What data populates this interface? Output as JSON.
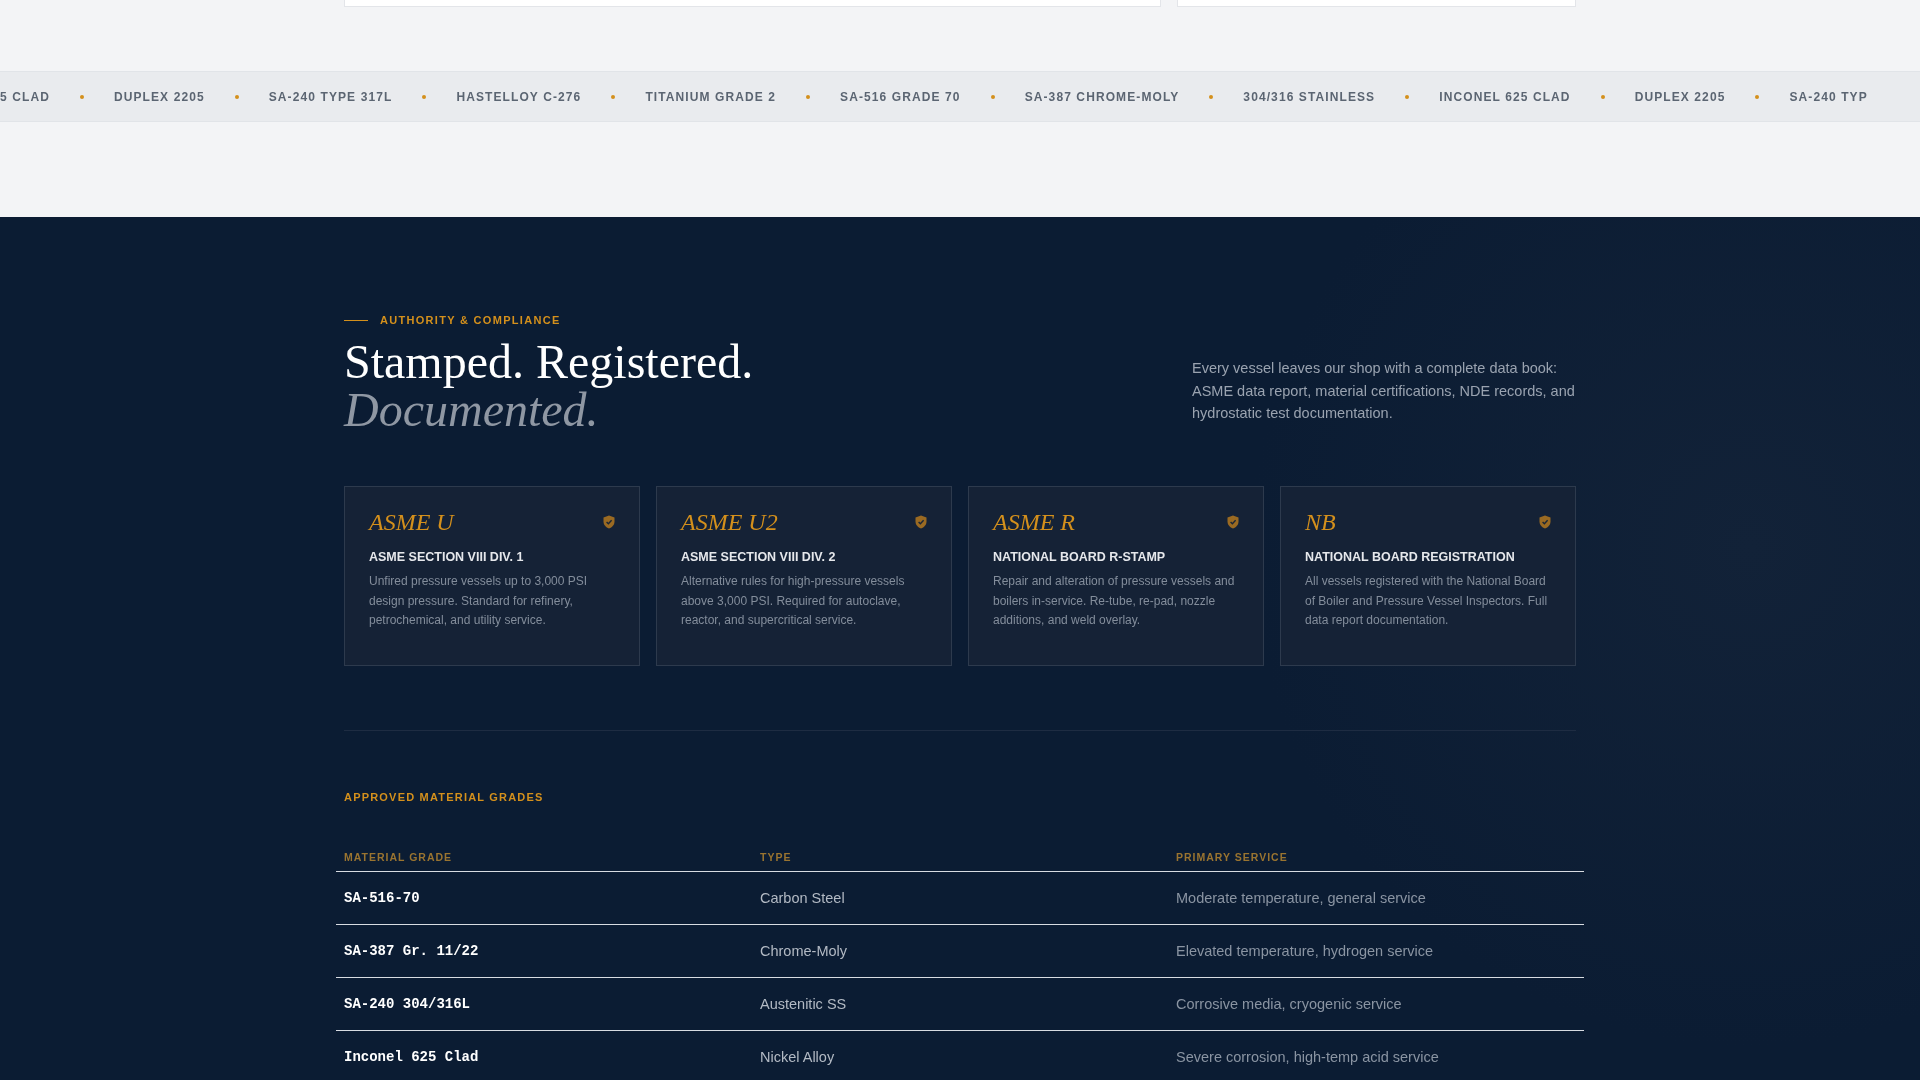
{
  "ticker": [
    "5 CLAD",
    "DUPLEX 2205",
    "SA-240 TYPE 317L",
    "HASTELLOY C-276",
    "TITANIUM GRADE 2",
    "SA-516 GRADE 70",
    "SA-387 CHROME-MOLY",
    "304/316 STAINLESS",
    "INCONEL 625 CLAD",
    "DUPLEX 2205",
    "SA-240 TYP"
  ],
  "section": {
    "eyebrow": "AUTHORITY & COMPLIANCE",
    "heading": "Stamped. Registered.",
    "heading_italic": "Documented.",
    "intro": "Every vessel leaves our shop with a complete data book: ASME data report, material certifications, NDE records, and hydrostatic test documentation."
  },
  "stamps": [
    {
      "code": "ASME U",
      "title": "ASME SECTION VIII DIV. 1",
      "text": "Unfired pressure vessels up to 3,000 PSI design pressure. Standard for refinery, petrochemical, and utility service."
    },
    {
      "code": "ASME U2",
      "title": "ASME SECTION VIII DIV. 2",
      "text": "Alternative rules for high-pressure vessels above 3,000 PSI. Required for autoclave, reactor, and supercritical service."
    },
    {
      "code": "ASME R",
      "title": "NATIONAL BOARD R-STAMP",
      "text": "Repair and alteration of pressure vessels and boilers in-service. Re-tube, re-pad, nozzle additions, and weld overlay."
    },
    {
      "code": "NB",
      "title": "NATIONAL BOARD REGISTRATION",
      "text": "All vessels registered with the National Board of Boiler and Pressure Vessel Inspectors. Full data report documentation."
    }
  ],
  "materials": {
    "title": "APPROVED MATERIAL GRADES",
    "columns": [
      "MATERIAL GRADE",
      "TYPE",
      "PRIMARY SERVICE"
    ],
    "rows": [
      [
        "SA-516-70",
        "Carbon Steel",
        "Moderate temperature, general service"
      ],
      [
        "SA-387 Gr. 11/22",
        "Chrome-Moly",
        "Elevated temperature, hydrogen service"
      ],
      [
        "SA-240 304/316L",
        "Austenitic SS",
        "Corrosive media, cryogenic service"
      ],
      [
        "Inconel 625 Clad",
        "Nickel Alloy",
        "Severe corrosion, high-temp acid service"
      ]
    ]
  }
}
